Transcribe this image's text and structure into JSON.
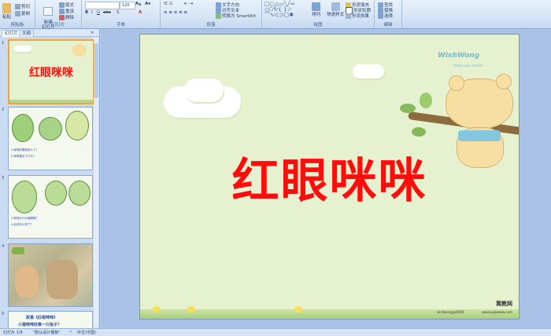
{
  "ribbon": {
    "clipboard": {
      "paste": "粘贴",
      "cut": "剪切",
      "copy": "复制",
      "label": "剪贴板"
    },
    "slides": {
      "new_slide": "新建\n幻灯片",
      "layout": "版式",
      "reset": "重设",
      "delete": "删除",
      "label": "幻灯片"
    },
    "font": {
      "size": "120",
      "label": "字体"
    },
    "paragraph": {
      "text_direction": "文字方向",
      "align_text": "对齐文本",
      "smartart": "转换为 SmartArt",
      "label": "段落"
    },
    "drawing": {
      "arrange": "排列",
      "quick_styles": "快速样式",
      "fill": "形状填充",
      "outline": "形状轮廓",
      "effects": "形状效果",
      "label": "绘图"
    },
    "editing": {
      "find": "查找",
      "replace": "替换",
      "select": "选择",
      "label": "编辑"
    }
  },
  "panel": {
    "tab_slides": "幻灯片",
    "tab_outline": "大纲"
  },
  "thumbnails": [
    {
      "num": "1",
      "title": "红眼咪咪",
      "logo": "WishWong"
    },
    {
      "num": "2",
      "line1": "1.咪咪的眼睛怎么了？",
      "line2": "2.咪咪看见了什么？"
    },
    {
      "num": "3",
      "line1": "3.咪咪为什么揉眼睛？",
      "line2": "4.后来怎么样了？"
    },
    {
      "num": "4"
    },
    {
      "num": "5",
      "line1": "故事《红眼咪咪》",
      "line2": "小猫咪咪好像一只兔子？"
    }
  ],
  "slide": {
    "title": "红眼咪咪",
    "logo": "WishWong",
    "logo_tagline": "follow your dream!",
    "footer_cn": "寓教网",
    "footer_url": "www.yujiaoww.com",
    "footer_left": "wishwong@2008"
  },
  "status": {
    "slide_pos": "幻灯片 1/9",
    "theme": "\"默认设计模板\"",
    "lang": "中文(中国)"
  },
  "colors": {
    "title": "#ff0d0d",
    "slide_bg": "#e6f1cf",
    "ribbon": "#d3e2f5"
  }
}
